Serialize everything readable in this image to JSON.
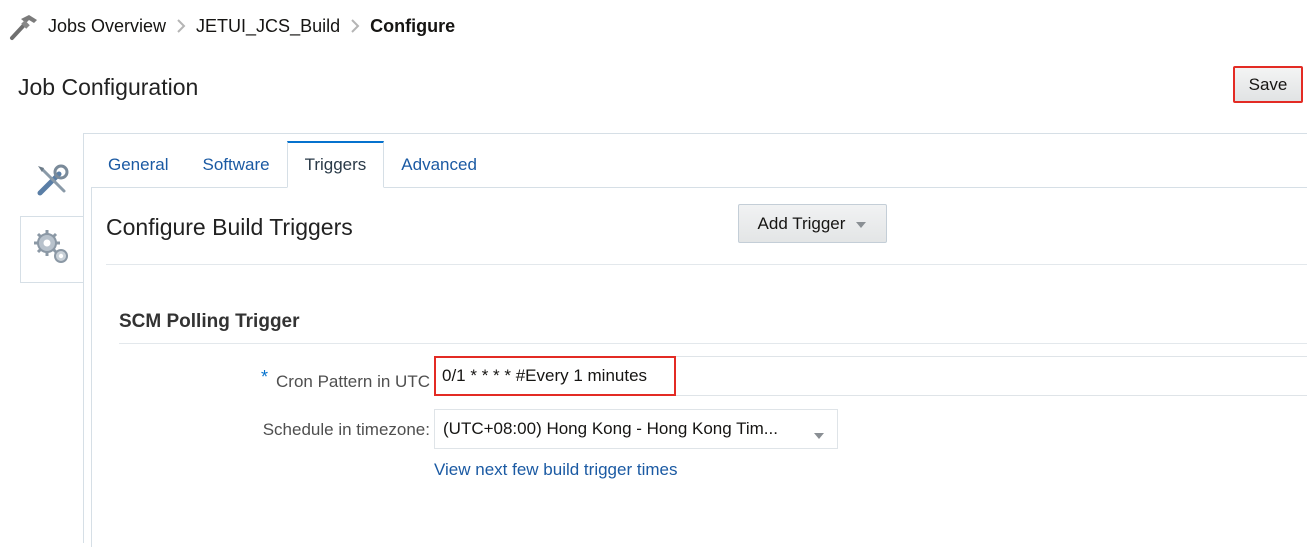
{
  "breadcrumb": {
    "items": [
      "Jobs Overview",
      "JETUI_JCS_Build",
      "Configure"
    ]
  },
  "page": {
    "title": "Job Configuration",
    "save_label": "Save"
  },
  "side_tabs": [
    {
      "icon": "wrench-screwdriver-icon",
      "active": false
    },
    {
      "icon": "gears-icon",
      "active": true
    }
  ],
  "tabs": [
    {
      "label": "General",
      "active": false
    },
    {
      "label": "Software",
      "active": false
    },
    {
      "label": "Triggers",
      "active": true
    },
    {
      "label": "Advanced",
      "active": false
    }
  ],
  "content": {
    "title": "Configure Build Triggers",
    "add_trigger_label": "Add Trigger",
    "scm": {
      "title": "SCM Polling Trigger",
      "cron_label": "Cron Pattern in UTC",
      "required_mark": "*",
      "cron_value": "0/1 * * * * #Every 1 minutes",
      "timezone_label": "Schedule in timezone:",
      "timezone_value": "(UTC+08:00) Hong Kong - Hong Kong Tim...",
      "next_times_link": "View next few build trigger times"
    }
  },
  "colors": {
    "highlight": "#e32b24",
    "link": "#1b5aa3",
    "tab_active_top": "#0572ce"
  }
}
